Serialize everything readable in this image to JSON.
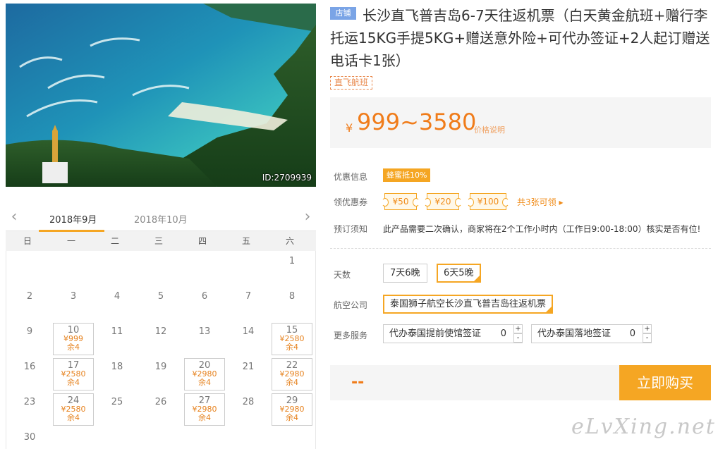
{
  "photo": {
    "id_text": "ID:2709939"
  },
  "calendar": {
    "prev_icon": "chevron-left-icon",
    "next_icon": "chevron-right-icon",
    "months": [
      "2018年9月",
      "2018年10月"
    ],
    "weekdays": [
      "日",
      "一",
      "二",
      "三",
      "四",
      "五",
      "六"
    ],
    "first_weekday": 6,
    "days_in_month": 30,
    "available": [
      {
        "day": 10,
        "price": "¥999",
        "stock": "余4"
      },
      {
        "day": 15,
        "price": "¥2580",
        "stock": "余4"
      },
      {
        "day": 17,
        "price": "¥2580",
        "stock": "余4"
      },
      {
        "day": 20,
        "price": "¥2980",
        "stock": "余4"
      },
      {
        "day": 22,
        "price": "¥2980",
        "stock": "余4"
      },
      {
        "day": 24,
        "price": "¥2580",
        "stock": "余4"
      },
      {
        "day": 27,
        "price": "¥2980",
        "stock": "余4"
      },
      {
        "day": 29,
        "price": "¥2980",
        "stock": "余4"
      }
    ]
  },
  "product": {
    "shop_tag": "店铺",
    "title": "长沙直飞普吉岛6-7天往返机票（白天黄金航班+赠行李托运15KG手提5KG+赠送意外险+可代办签证+2人起订赠送电话卡1张）",
    "flight_tag": "直飞航班",
    "currency": "¥",
    "price": "999~3580",
    "price_note": "价格说明"
  },
  "info": {
    "discount_label": "优惠信息",
    "discount": "蜂蜜抵10%",
    "coupon_label": "领优惠券",
    "coupons": [
      "¥50",
      "¥20",
      "¥100"
    ],
    "coupon_all": "共3张可领 ▸",
    "notice_label": "预订须知",
    "notice": "此产品需要二次确认，商家将在2个工作小时内（工作日9:00-18:00）核实是否有位!"
  },
  "options": {
    "days_label": "天数",
    "days": [
      "7天6晚",
      "6天5晚"
    ],
    "days_selected": 1,
    "airline_label": "航空公司",
    "airline": "泰国狮子航空长沙直飞普吉岛往返机票",
    "services_label": "更多服务",
    "services": [
      {
        "name": "代办泰国提前使馆签证",
        "count": "0"
      },
      {
        "name": "代办泰国落地签证",
        "count": "0"
      }
    ],
    "plus": "+",
    "minus": "-"
  },
  "buy": {
    "total": "--",
    "button": "立即购买"
  },
  "watermark": "eLvXing.net",
  "colors": {
    "accent": "#f5a623",
    "price": "#f07c1a",
    "shop_tag": "#7aa4e6"
  }
}
